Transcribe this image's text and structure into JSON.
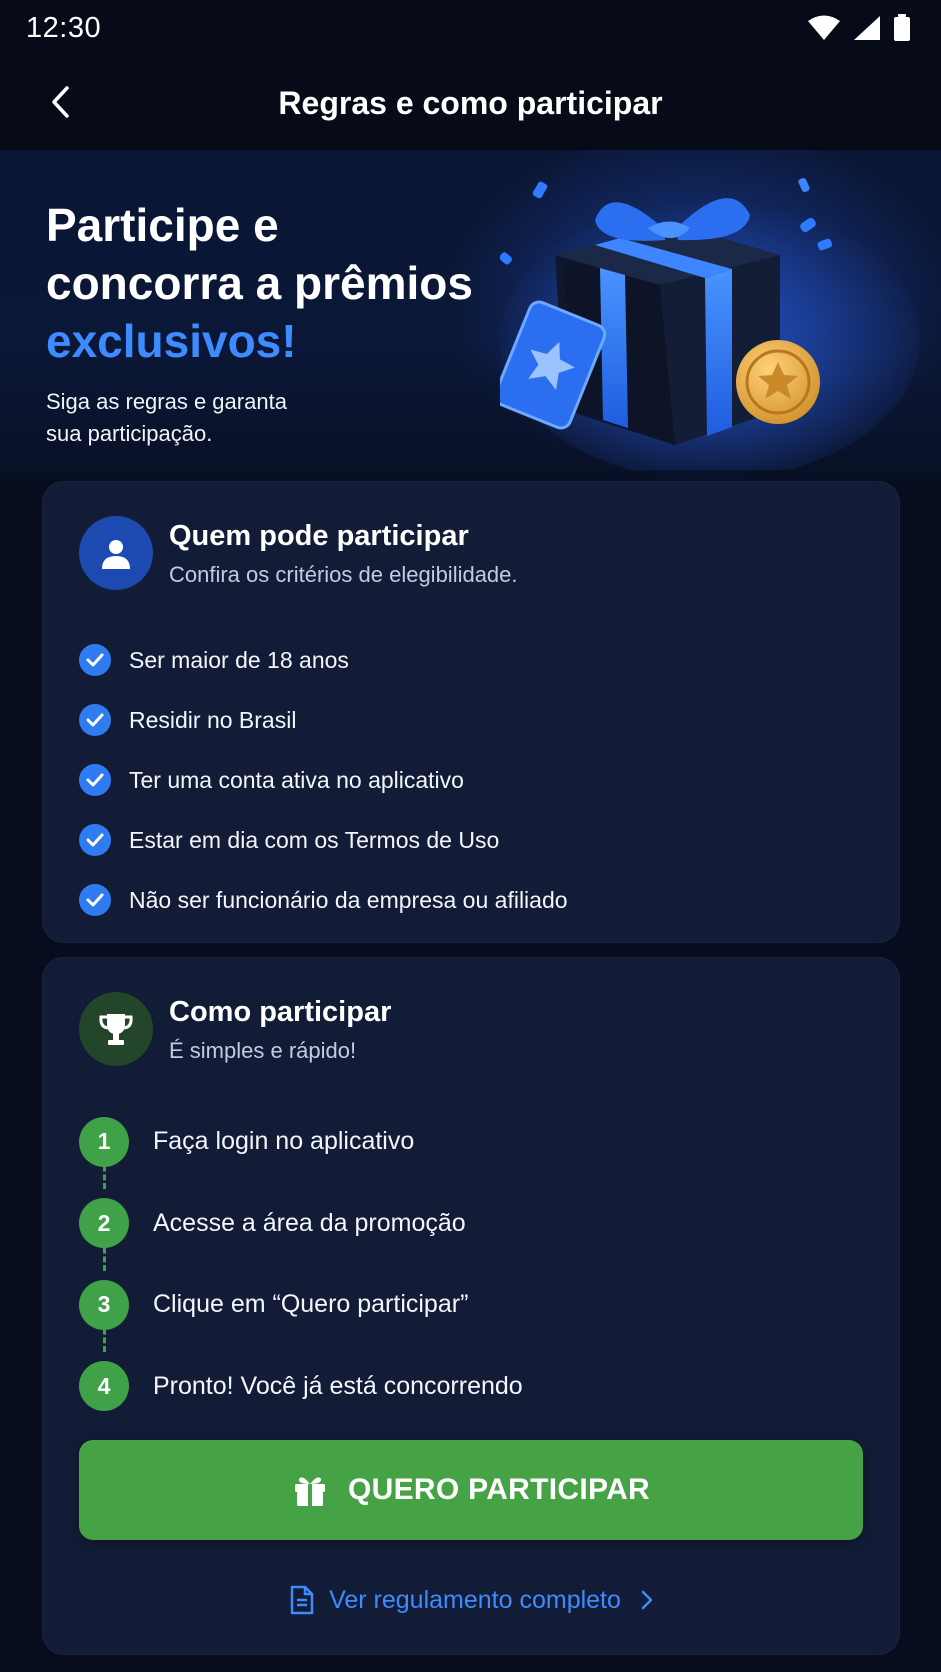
{
  "status_bar": {
    "time": "12:30"
  },
  "app_bar": {
    "title": "Regras e como participar"
  },
  "hero": {
    "title_lines": [
      "Participe e",
      "concorra a prêmios",
      "exclusivos!"
    ],
    "subtitle_lines": [
      "Siga as regras e garanta",
      "sua participação."
    ]
  },
  "eligibility": {
    "title": "Quem pode participar",
    "subtitle": "Confira os critérios de elegibilidade.",
    "items": [
      "Ser maior de 18 anos",
      "Residir no Brasil",
      "Ter uma conta ativa no aplicativo",
      "Estar em dia com os Termos de Uso",
      "Não ser funcionário da empresa ou afiliado"
    ]
  },
  "how_to": {
    "title": "Como participar",
    "subtitle": "É simples e rápido!",
    "steps": [
      {
        "number": "1",
        "text": "Faça login no aplicativo"
      },
      {
        "number": "2",
        "text": "Acesse a área da promoção"
      },
      {
        "number": "3",
        "text": "Clique em “Quero participar”"
      },
      {
        "number": "4",
        "text": "Pronto! Você já está concorrendo"
      }
    ],
    "cta_label": "QUERO PARTICIPAR",
    "link_label": "Ver regulamento completo"
  },
  "icons": {
    "back": "chevron-left-icon",
    "eligibility": "user-icon",
    "how_to": "trophy-icon",
    "check": "check-circle-icon",
    "cta": "gift-icon",
    "link": "document-icon",
    "link_arrow": "chevron-right-icon"
  },
  "colors": {
    "background": "#070d1e",
    "card": "#121c36",
    "accent_blue": "#3d8bff",
    "check_blue": "#2f7bf2",
    "green": "#45a245",
    "step_green": "#3fa148"
  }
}
